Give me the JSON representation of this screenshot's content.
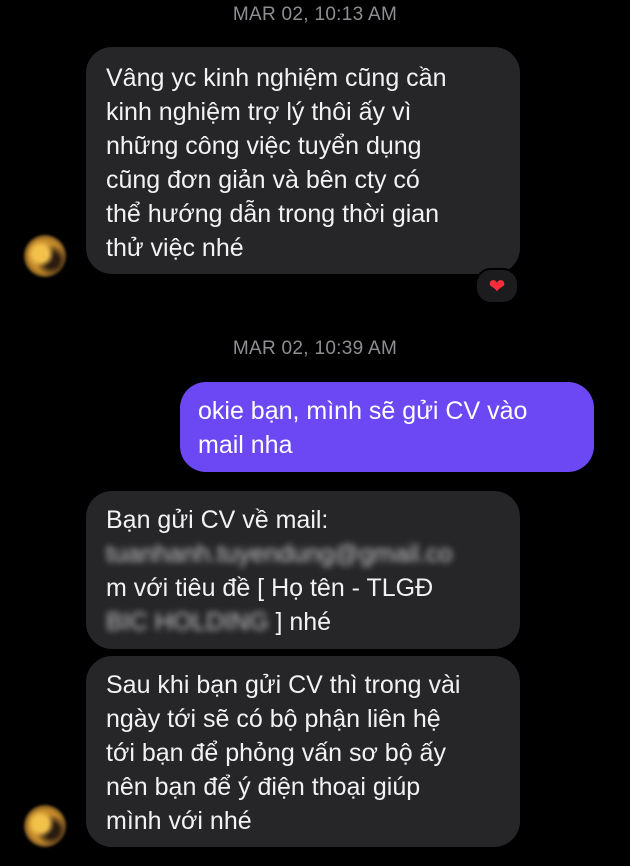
{
  "messages_timeline": {
    "timestamp_1": "MAR 02, 10:13 AM",
    "timestamp_2": "MAR 02, 10:39 AM"
  },
  "message_1": {
    "lines": [
      "Vâng yc kinh nghiệm cũng cần",
      "kinh nghiệm trợ lý thôi ấy vì",
      "những công việc tuyển dụng",
      "cũng đơn giản và bên cty có",
      "thể hướng dẫn trong thời gian",
      "thử việc nhé"
    ],
    "reaction": "❤"
  },
  "message_2": {
    "lines": [
      "okie bạn, mình sẽ gửi CV vào",
      "mail nha"
    ]
  },
  "message_3": {
    "line_1": "Bạn gửi CV về mail:",
    "line_2_blurred": "tuanhanh.tuyendung@gmail.co",
    "line_3": "m với tiêu đề [ Họ tên - TLGĐ",
    "line_4_blurred": "BIC HOLDING",
    "line_4_suffix": "] nhé"
  },
  "message_4": {
    "lines": [
      "Sau khi bạn gửi CV thì trong vài",
      "ngày tới sẽ có bộ phận liên hệ",
      "tới bạn để phỏng vấn sơ bộ ấy",
      "nên bạn để ý điện thoại giúp",
      "mình với nhé"
    ]
  },
  "colors": {
    "incoming_bubble": "#262629",
    "outgoing_bubble": "#6b48f4",
    "timestamp": "#8e8e93",
    "reaction_heart": "#ff2d3b"
  }
}
